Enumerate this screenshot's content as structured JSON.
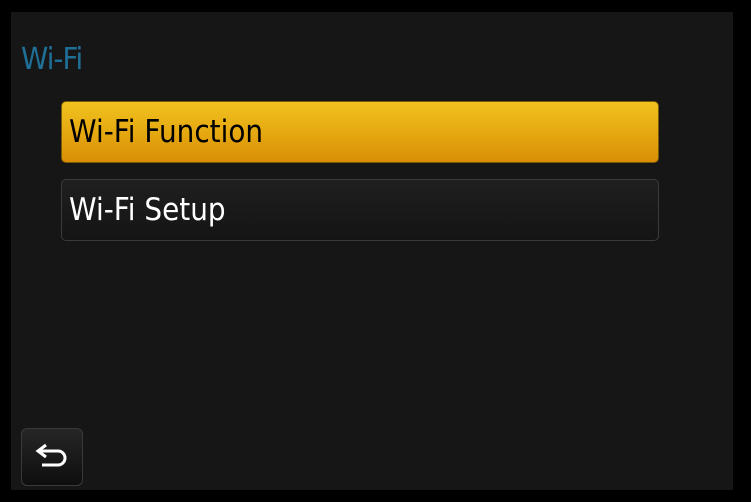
{
  "header": {
    "title": "Wi-Fi"
  },
  "menu": {
    "items": [
      {
        "label": "Wi-Fi Function",
        "selected": true
      },
      {
        "label": "Wi-Fi Setup",
        "selected": false
      }
    ]
  },
  "footer": {
    "back_icon": "return-arrow-icon"
  },
  "colors": {
    "background": "#161616",
    "title": "#1f6f97",
    "selected_item": "#e6a911",
    "item_text": "#ffffff"
  }
}
